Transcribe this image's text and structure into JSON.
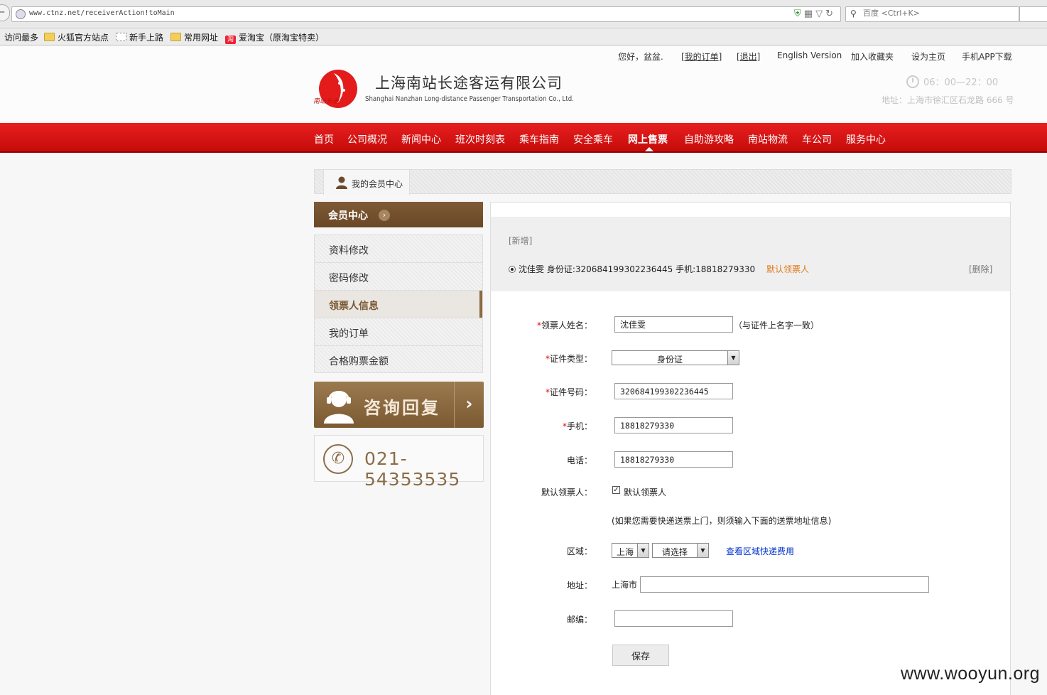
{
  "browser": {
    "url": "www.ctnz.net/receiverAction!toMain",
    "search_placeholder": "百度 <Ctrl+K>",
    "bookmarks": [
      "访问最多",
      "火狐官方站点",
      "新手上路",
      "常用网址",
      "爱淘宝（原淘宝特卖）"
    ],
    "taobao_badge": "淘"
  },
  "header": {
    "toplinks": [
      "您好，盆盆.",
      "[我的订单]",
      "[退出]",
      "English Version",
      "加入收藏夹",
      "设为主页",
      "手机APP下载"
    ],
    "company_cn": "上海南站长途客运有限公司",
    "company_en": "Shanghai Nanzhan Long-distance Passenger Transportation Co., Ltd.",
    "logo_text": "南站长途",
    "hours": "06：00—22：00",
    "address": "地址：上海市徐汇区石龙路 666 号"
  },
  "nav": {
    "items": [
      "首页",
      "公司概况",
      "新闻中心",
      "班次时刻表",
      "乘车指南",
      "安全乘车",
      "网上售票",
      "自助游攻略",
      "南站物流",
      "车公司",
      "服务中心"
    ],
    "active": "网上售票"
  },
  "breadcrumb": {
    "tab": "我的会员中心"
  },
  "sidebar": {
    "title": "会员中心",
    "items": [
      "资料修改",
      "密码修改",
      "领票人信息",
      "我的订单",
      "合格购票金额"
    ],
    "active": "领票人信息",
    "consult_label": "咨询回复",
    "phone": "021-54353535"
  },
  "receiver_list": {
    "add_link": "[新增]",
    "entry": "沈佳雯  身份证:320684199302236445  手机:18818279330",
    "default_tag": "默认领票人",
    "delete_link": "[删除]"
  },
  "form": {
    "name_label": "领票人姓名：",
    "name_value": "沈佳雯",
    "name_hint": "（与证件上名字一致）",
    "idtype_label": "证件类型：",
    "idtype_value": "身份证",
    "idno_label": "证件号码：",
    "idno_value": "320684199302236445",
    "mobile_label": "手机：",
    "mobile_value": "18818279330",
    "phone_label": "电话：",
    "phone_value": "18818279330",
    "default_label": "默认领票人：",
    "default_checkbox_label": "默认领票人",
    "default_checked": true,
    "express_note": "(如果您需要快递送票上门，则须输入下面的送票地址信息)",
    "region_label": "区域：",
    "region_city": "上海",
    "region_district": "请选择",
    "region_fee_link": "查看区域快递费用",
    "address_label": "地址：",
    "address_prefix": "上海市",
    "address_value": "",
    "zip_label": "邮编：",
    "zip_value": "",
    "save_label": "保存",
    "required_mark": "*"
  },
  "watermark": "www.wooyun.org",
  "colors": {
    "nav_red": "#d61515",
    "brown": "#7a5a35",
    "orange_tag": "#e07a1a",
    "link_blue": "#0033cc"
  }
}
